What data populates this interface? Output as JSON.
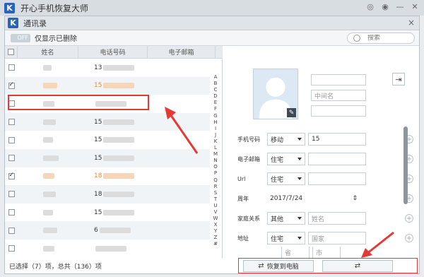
{
  "window": {
    "title": "开心手机恢复大师",
    "logo_letter": "K"
  },
  "subwindow": {
    "title": "通讯录",
    "close": "×"
  },
  "toolbar": {
    "toggle_label": "OFF",
    "filter_label": "仅显示已删除",
    "search_placeholder": "搜索"
  },
  "table": {
    "headers": {
      "name": "姓名",
      "phone": "电话号码",
      "email": "电子邮箱"
    },
    "rows": [
      {
        "checked": false,
        "phone": "13",
        "orange": false
      },
      {
        "checked": true,
        "phone": "15",
        "orange": true
      },
      {
        "checked": false,
        "phone": "",
        "orange": false
      },
      {
        "checked": false,
        "phone": "15",
        "orange": false
      },
      {
        "checked": false,
        "phone": "15",
        "orange": false
      },
      {
        "checked": false,
        "phone": "15",
        "orange": false
      },
      {
        "checked": true,
        "phone": "18",
        "orange": true
      },
      {
        "checked": false,
        "phone": "18",
        "orange": false
      },
      {
        "checked": false,
        "phone": "15",
        "orange": false
      },
      {
        "checked": false,
        "phone": "6",
        "orange": false
      },
      {
        "checked": false,
        "phone": "",
        "orange": false
      }
    ],
    "alphabet": [
      "A",
      "B",
      "C",
      "D",
      "E",
      "F",
      "G",
      "H",
      "I",
      "J",
      "K",
      "L",
      "M",
      "N",
      "O",
      "P",
      "Q",
      "R",
      "S",
      "T",
      "U",
      "V",
      "W",
      "X",
      "Y",
      "Z",
      "#"
    ]
  },
  "status": {
    "summary": "已选择（7）项，总共（136）项"
  },
  "detail": {
    "middle_name_placeholder": "中间名",
    "phone_label": "手机号码",
    "phone_type": "移动",
    "phone_value": "15",
    "email_label": "电子邮箱",
    "email_type": "住宅",
    "url_label": "Url",
    "url_type": "住宅",
    "anniversary_label": "周年",
    "anniversary_value": "2017/7/24",
    "family_label": "家庭关系",
    "family_type": "其他",
    "family_placeholder": "姓名",
    "address_label": "地址",
    "address_type": "住宅",
    "country_placeholder": "国家",
    "province_placeholder": "省",
    "city_placeholder": "市"
  },
  "actions": {
    "restore_to_pc": "恢复到电脑"
  }
}
